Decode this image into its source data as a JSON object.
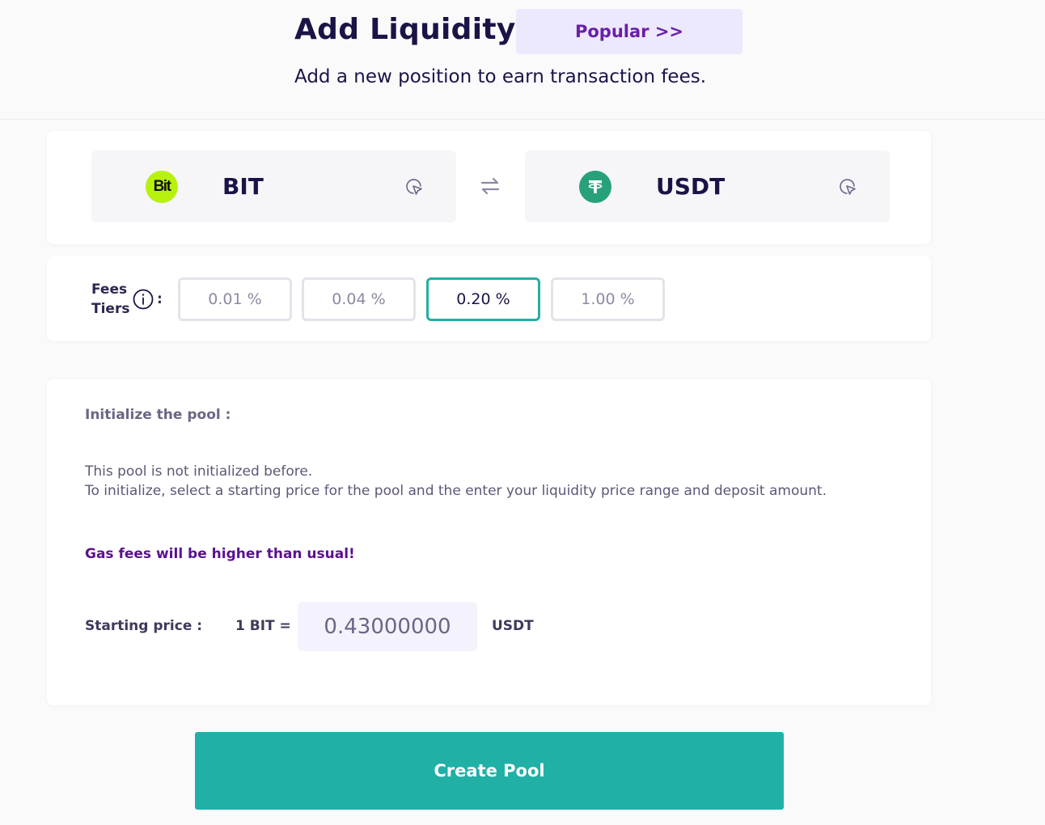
{
  "header": {
    "title": "Add Liquidity",
    "popular_label": "Popular >>",
    "subtitle": "Add a new position to earn transaction fees."
  },
  "tokens": {
    "token_a": {
      "symbol": "BIT",
      "logo_text": "Bit",
      "logo_color": "#b7f20e",
      "icon": "select-token-icon"
    },
    "token_b": {
      "symbol": "USDT",
      "logo_text": "₮",
      "logo_color": "#26a17b",
      "icon": "select-token-icon"
    },
    "swap_icon": "swap-arrows-icon"
  },
  "fees": {
    "label_line1": "Fees",
    "label_line2": "Tiers",
    "colon": ":",
    "info_icon": "info-icon",
    "tiers": [
      "0.01 %",
      "0.04 %",
      "0.20 %",
      "1.00 %"
    ],
    "selected": "0.20 %"
  },
  "init": {
    "title": "Initialize the pool :",
    "line1": "This pool is not initialized before.",
    "line2": "To initialize, select a starting price for the pool and the enter your liquidity price range and deposit amount.",
    "gas_warning": "Gas fees will be higher than usual!",
    "starting_price_label": "Starting price :",
    "unit_left": "1 BIT =",
    "price_value": "0.43000000",
    "unit_right": "USDT"
  },
  "actions": {
    "create_pool_label": "Create Pool"
  },
  "colors": {
    "accent": "#20b0a6",
    "brand_purple": "#6a1fa8",
    "warning": "#5b1190"
  }
}
